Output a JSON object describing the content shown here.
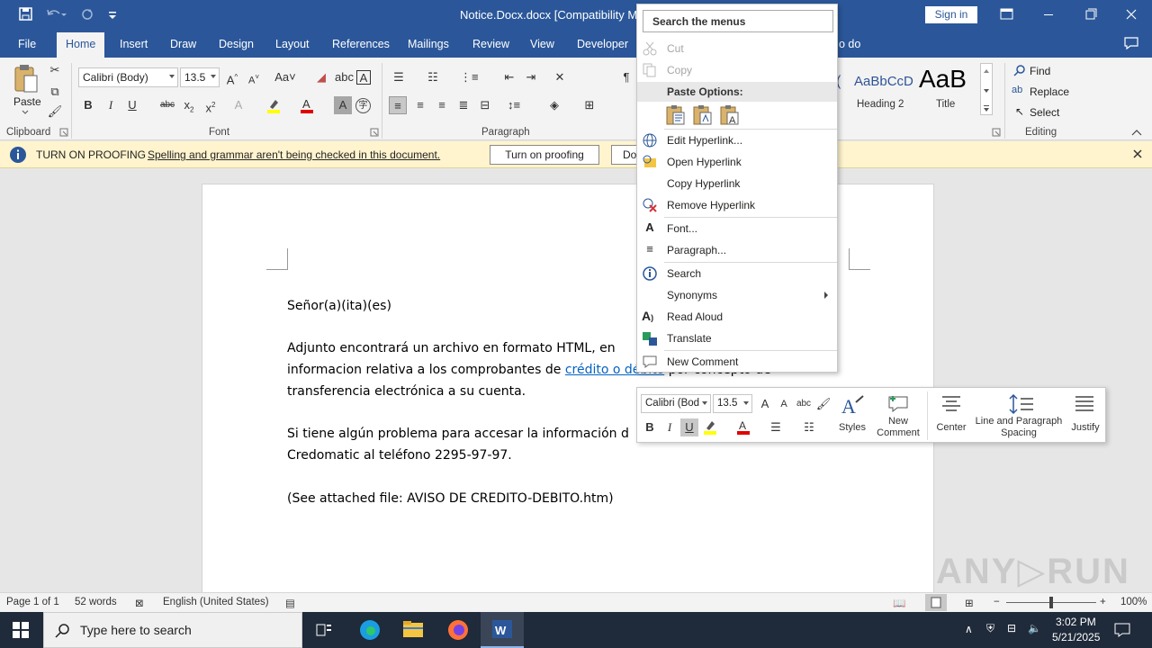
{
  "titlebar": {
    "doc_title": "Notice.Docx.docx [Compatibility Mo",
    "signin": "Sign in"
  },
  "tabs": [
    "File",
    "Home",
    "Insert",
    "Draw",
    "Design",
    "Layout",
    "References",
    "Mailings",
    "Review",
    "View",
    "Developer"
  ],
  "tell_me_partial": "o do",
  "ribbon": {
    "paste_label": "Paste",
    "font_name": "Calibri (Body)",
    "font_size": "13.5",
    "clipboard_label": "Clipboard",
    "font_label": "Font",
    "paragraph_label": "Paragraph",
    "editing_label": "Editing",
    "styles": [
      {
        "preview": "AaBbCcD",
        "name": "Heading 2"
      },
      {
        "preview": "AaB",
        "name": "Title"
      }
    ],
    "find": "Find",
    "replace": "Replace",
    "select": "Select"
  },
  "infobar": {
    "title": "TURN ON PROOFING",
    "message": "Spelling and grammar aren't being checked in this document.",
    "button1": "Turn on proofing",
    "button2": "Do"
  },
  "document": {
    "greeting": "Señor(a)(ita)(es)",
    "p1_line1": "Adjunto  encontrará un archivo en formato HTML, en",
    "p1_line2_a": "informacion relativa a los comprobantes de ",
    "p1_line2_link": "crédito o débito",
    "p1_line2_b": " por concepto de",
    "p1_line3": "transferencia electrónica a su cuenta.",
    "p2_line1": "Si tiene algún problema para accesar la información d",
    "p2_line2": "Credomatic al teléfono 2295-97-97.",
    "p3": "(See attached file: AVISO DE CREDITO-DEBITO.htm)"
  },
  "context_menu": {
    "search_placeholder": "Search the menus",
    "cut": "Cut",
    "copy": "Copy",
    "paste_options": "Paste Options:",
    "edit_hyperlink": "Edit Hyperlink...",
    "open_hyperlink": "Open Hyperlink",
    "copy_hyperlink": "Copy Hyperlink",
    "remove_hyperlink": "Remove Hyperlink",
    "font": "Font...",
    "paragraph": "Paragraph...",
    "search": "Search",
    "synonyms": "Synonyms",
    "read_aloud": "Read Aloud",
    "translate": "Translate",
    "new_comment": "New Comment"
  },
  "mini_toolbar": {
    "font": "Calibri (Bod",
    "size": "13.5",
    "styles": "Styles",
    "new_comment": "New Comment",
    "center": "Center",
    "line_spacing": "Line and Paragraph Spacing",
    "justify": "Justify"
  },
  "statusbar": {
    "page": "Page 1 of 1",
    "words": "52 words",
    "language": "English (United States)",
    "zoom": "100%"
  },
  "taskbar": {
    "search_placeholder": "Type here to search",
    "time": "3:02 PM",
    "date": "5/21/2025"
  },
  "colors": {
    "word_blue": "#2b579a",
    "infobar_bg": "#fff4ce",
    "link": "#0563c1"
  }
}
